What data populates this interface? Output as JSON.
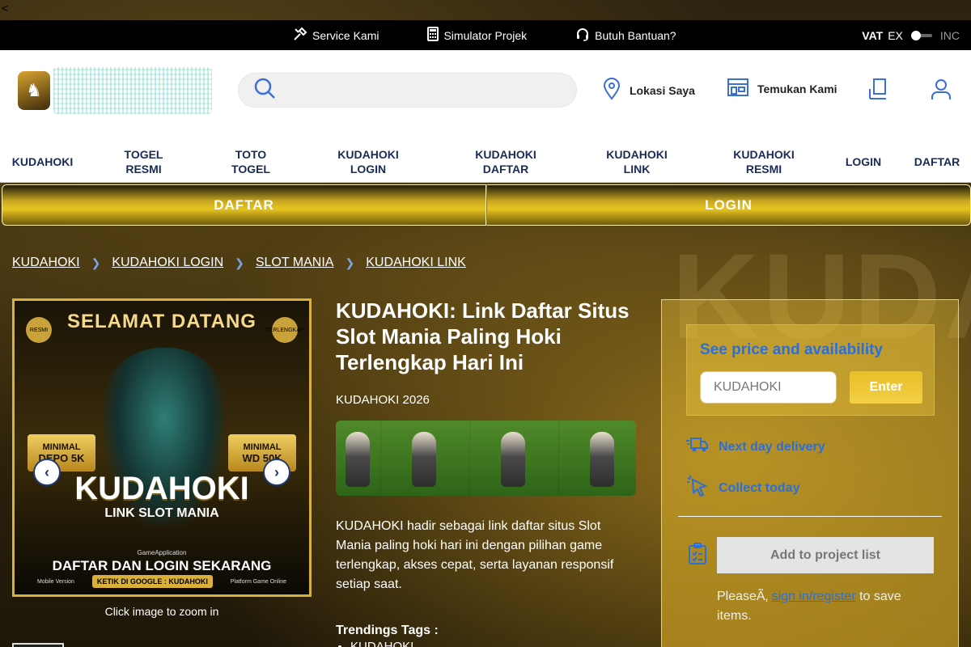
{
  "topbar": {
    "back_char": "<",
    "links": [
      {
        "label": "Service Kami",
        "icon": "tools-icon"
      },
      {
        "label": "Simulator Projek",
        "icon": "calculator-icon"
      },
      {
        "label": "Butuh Bantuan?",
        "icon": "headset-icon"
      }
    ],
    "vat": {
      "label": "VAT",
      "ex": "EX",
      "inc": "INC"
    }
  },
  "header": {
    "search_placeholder": "",
    "location_label": "Lokasi Saya",
    "find_label": "Temukan Kami"
  },
  "nav": [
    "KUDAHOKI",
    "TOGEL RESMI",
    "TOTO TOGEL",
    "KUDAHOKI LOGIN",
    "KUDAHOKI DAFTAR",
    "KUDAHOKI LINK",
    "KUDAHOKI RESMI",
    "LOGIN",
    "DAFTAR"
  ],
  "cta": {
    "daftar": "DAFTAR",
    "login": "LOGIN"
  },
  "breadcrumbs": [
    "KUDAHOKI",
    "KUDAHOKI LOGIN",
    "SLOT MANIA",
    "KUDAHOKI LINK"
  ],
  "gallery": {
    "top": "SELAMAT DATANG",
    "badge_left": "RESMI",
    "badge_right": "TERLENGKAP",
    "plate_left": {
      "small": "MINIMAL",
      "big": "DEPO 5K"
    },
    "plate_right": {
      "small": "MINIMAL",
      "big": "WD 50K"
    },
    "title": "KUDAHOKI",
    "subtitle": "LINK SLOT MANIA",
    "app": "GameApplication",
    "cta": "DAFTAR DAN LOGIN SEKARANG",
    "foot_left": "Mobile Version",
    "foot_pill": "KETIK DI GOOGLE : KUDAHOKI",
    "foot_right": "Platform Game Online",
    "zoom_hint": "Click image to zoom in"
  },
  "product": {
    "title": "KUDAHOKI: Link Daftar Situs Slot Mania Paling Hoki Terlengkap Hari Ini",
    "subtitle": "KUDAHOKI 2026",
    "description": "KUDAHOKI hadir sebagai link daftar situs Slot Mania paling hoki hari ini dengan pilihan game terlengkap, akses cepat, serta layanan responsif setiap saat.",
    "tags_heading": "Trendings Tags :",
    "tags": [
      "KUDAHOKI"
    ]
  },
  "panel": {
    "price_title": "See price and availability",
    "input_value": "KUDAHOKI",
    "enter_label": "Enter",
    "next_day": "Next day delivery",
    "collect": "Collect today",
    "add_project": "Add to project list",
    "note_prefix": "PleaseÃ‚ ",
    "note_link": "sign in/register",
    "note_suffix": " to save items."
  },
  "colors": {
    "accent": "#2b6fd9",
    "gold": "#e8c420",
    "nav_text": "#1a2b57"
  }
}
